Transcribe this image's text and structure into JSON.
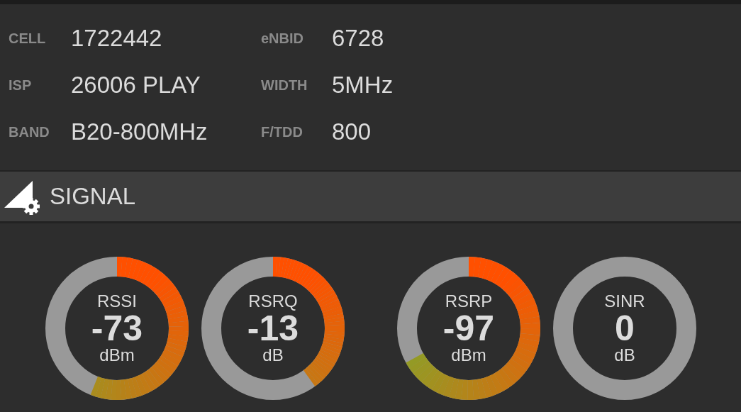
{
  "info": [
    {
      "label": "CELL",
      "value": "1722442"
    },
    {
      "label": "eNBID",
      "value": "6728"
    },
    {
      "label": "ISP",
      "value": "26006 PLAY"
    },
    {
      "label": "WIDTH",
      "value": "5MHz"
    },
    {
      "label": "BAND",
      "value": "B20-800MHz"
    },
    {
      "label": "F/TDD",
      "value": "800"
    }
  ],
  "section": {
    "title": "SIGNAL"
  },
  "gauges": [
    {
      "name": "RSSI",
      "value": "-73",
      "unit": "dBm"
    },
    {
      "name": "RSRQ",
      "value": "-13",
      "unit": "dB"
    },
    {
      "name": "RSRP",
      "value": "-97",
      "unit": "dBm"
    },
    {
      "name": "SINR",
      "value": "0",
      "unit": "dB"
    }
  ]
}
